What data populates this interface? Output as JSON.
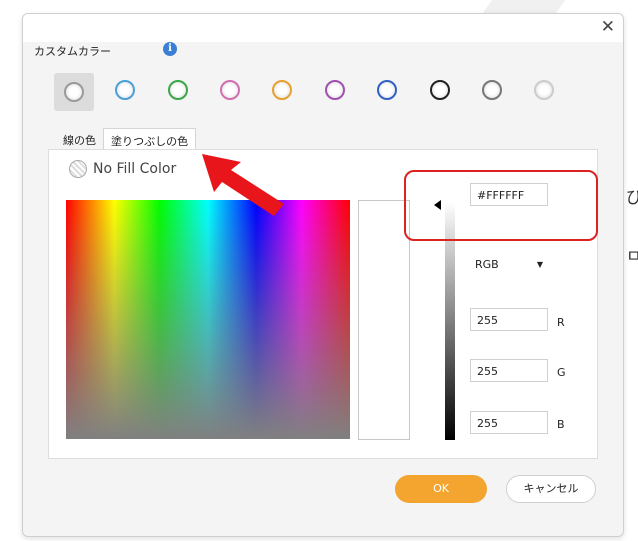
{
  "dialog": {
    "title": "カスタムカラー",
    "info_icon": "info-icon",
    "close_icon": "close-icon"
  },
  "swatches": [
    {
      "name": "white",
      "color": "#ffffff",
      "border": "#9a9a9a"
    },
    {
      "name": "light-blue",
      "color": "#ffffff",
      "border": "#4aa0d8"
    },
    {
      "name": "green",
      "color": "#ffffff",
      "border": "#3aa84a"
    },
    {
      "name": "pink",
      "color": "#ffffff",
      "border": "#d070b0"
    },
    {
      "name": "orange",
      "color": "#ffffff",
      "border": "#e8a030"
    },
    {
      "name": "purple",
      "color": "#ffffff",
      "border": "#a050b0"
    },
    {
      "name": "blue",
      "color": "#ffffff",
      "border": "#3060c8"
    },
    {
      "name": "black",
      "color": "#ffffff",
      "border": "#222222"
    },
    {
      "name": "gray",
      "color": "#ffffff",
      "border": "#777777"
    },
    {
      "name": "light-gray",
      "color": "#ffffff",
      "border": "#cccccc"
    }
  ],
  "tabs": [
    "線の色",
    "塗りつぶしの色"
  ],
  "no_fill_label": "No Fill Color",
  "hex_value": "#FFFFFF",
  "color_mode": "RGB",
  "rgb": {
    "r_value": "255",
    "r_label": "R",
    "g_value": "255",
    "g_label": "G",
    "b_value": "255",
    "b_label": "B"
  },
  "buttons": {
    "ok": "OK",
    "cancel": "キャンセル"
  },
  "background_fragments": [
    "び",
    "ㅁ"
  ],
  "colors": {
    "accent": "#f3a530",
    "annotation": "#dd2222"
  }
}
